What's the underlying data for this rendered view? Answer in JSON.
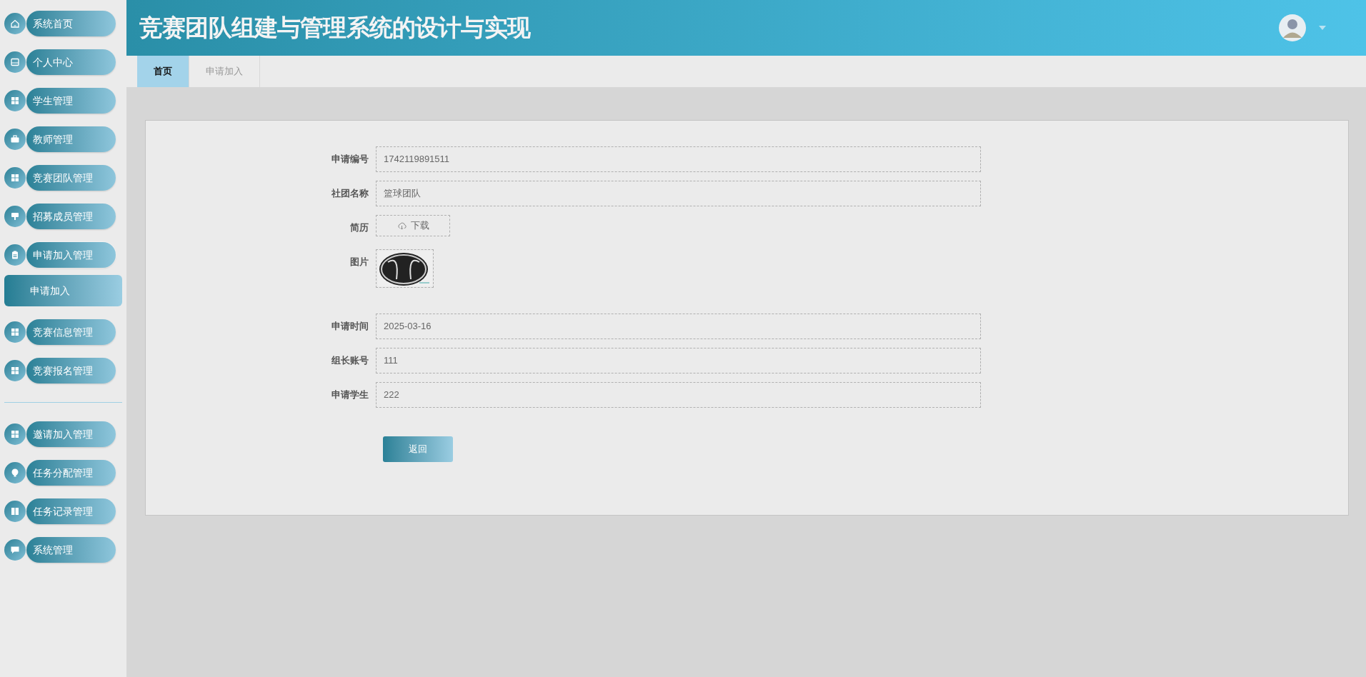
{
  "header": {
    "title": "竞赛团队组建与管理系统的设计与实现"
  },
  "sidebar": {
    "items": [
      {
        "kind": "menu",
        "label": "系统首页",
        "expanded": false
      },
      {
        "kind": "menu",
        "label": "个人中心",
        "expanded": false
      },
      {
        "kind": "menu",
        "label": "学生管理",
        "expanded": false
      },
      {
        "kind": "menu",
        "label": "教师管理",
        "expanded": false
      },
      {
        "kind": "menu",
        "label": "竞赛团队管理",
        "expanded": false
      },
      {
        "kind": "menu",
        "label": "招募成员管理",
        "expanded": false
      },
      {
        "kind": "menu",
        "label": "申请加入管理",
        "expanded": true,
        "children": [
          {
            "label": "申请加入",
            "selected": true
          }
        ]
      },
      {
        "kind": "menu",
        "label": "竞赛信息管理",
        "expanded": false
      },
      {
        "kind": "menu",
        "label": "竞赛报名管理",
        "expanded": false
      },
      {
        "kind": "divider"
      },
      {
        "kind": "menu",
        "label": "邀请加入管理",
        "expanded": false
      },
      {
        "kind": "menu",
        "label": "任务分配管理",
        "expanded": false
      },
      {
        "kind": "menu",
        "label": "任务记录管理",
        "expanded": false
      },
      {
        "kind": "menu",
        "label": "系统管理",
        "expanded": false
      }
    ]
  },
  "tabs": [
    {
      "label": "首页",
      "selected": true
    },
    {
      "label": "申请加入",
      "selected": false
    }
  ],
  "form": {
    "fields": [
      {
        "kind": "text",
        "label": "申请编号",
        "value": "1742119891511"
      },
      {
        "kind": "text",
        "label": "社团名称",
        "value": "篮球团队"
      },
      {
        "kind": "file",
        "label": "简历",
        "value": "下载"
      },
      {
        "label": "图片"
      },
      {
        "kind": "text",
        "label": "申请时间",
        "value": "2025-03-16"
      },
      {
        "kind": "text",
        "label": "组长账号",
        "value": "111"
      },
      {
        "kind": "text",
        "label": "申请学生",
        "value": "222"
      }
    ],
    "buttons": [
      "返回"
    ]
  }
}
